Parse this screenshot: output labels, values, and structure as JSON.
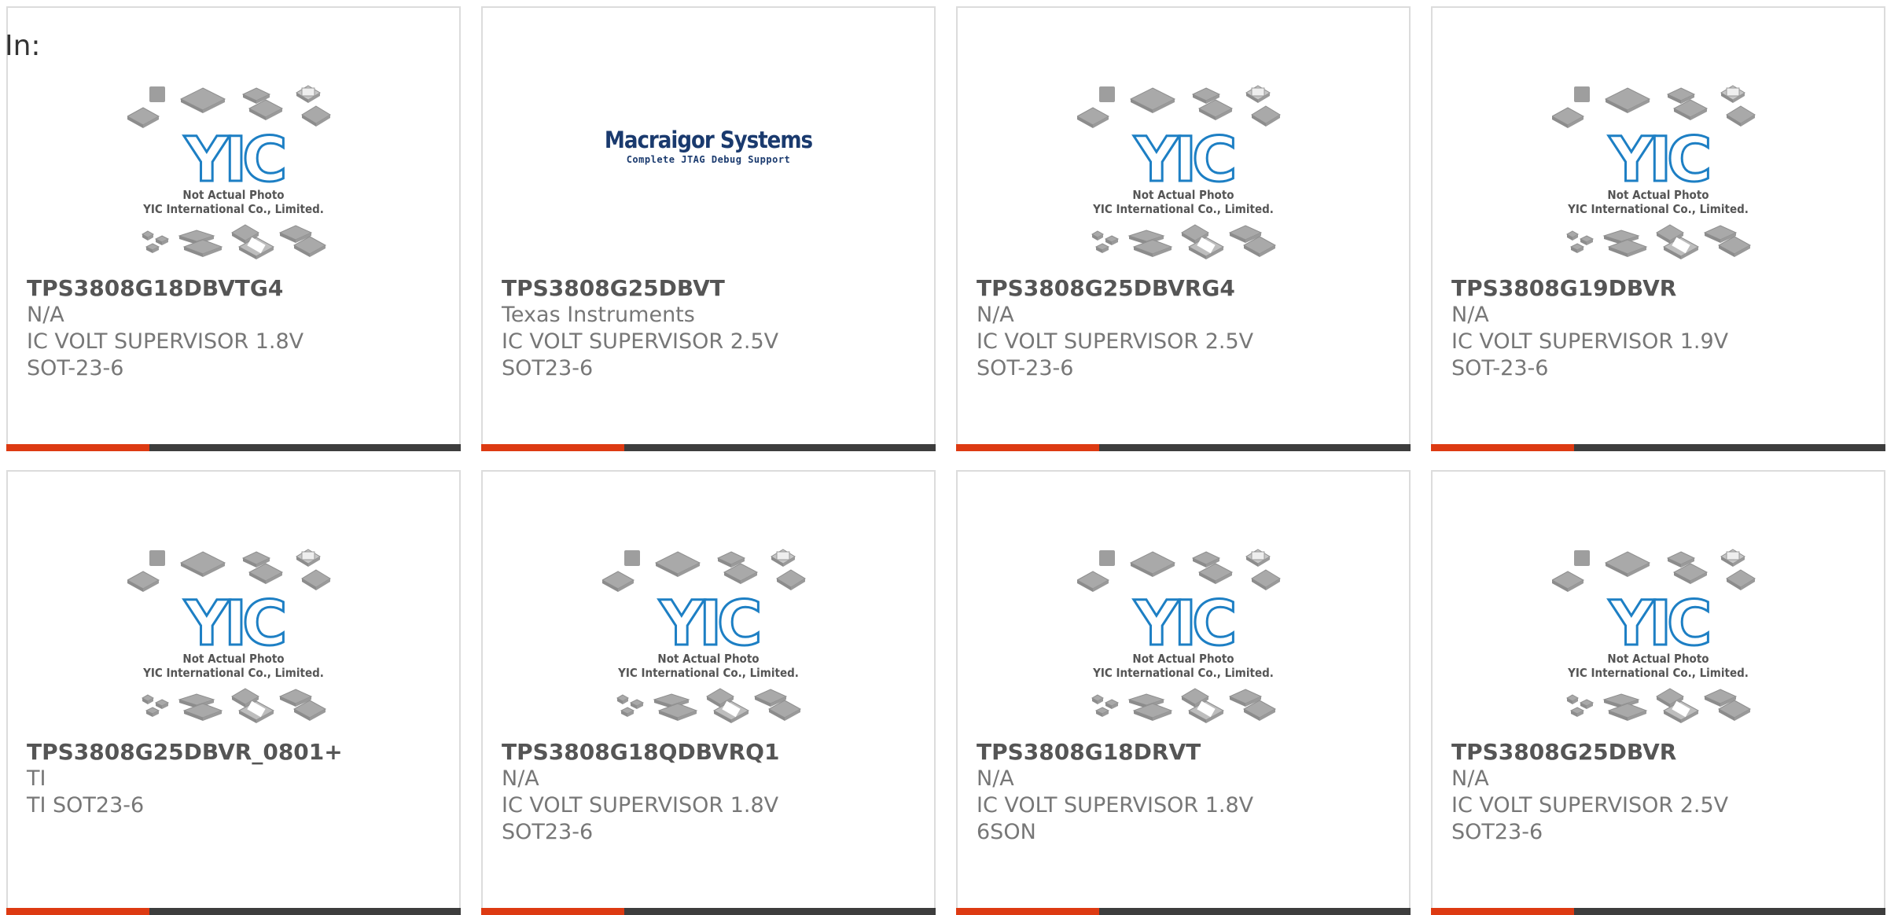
{
  "heading": "In:",
  "colors": {
    "accent": "#dd3a12",
    "bar": "#3d3d3d",
    "border": "#dcdcdc",
    "yic_blue": "#1d7fc4",
    "macraigor_navy": "#1a3a6e"
  },
  "placeholder_image": {
    "line1": "Not Actual Photo",
    "line2": "YIC International Co., Limited.",
    "logo_text": "YIC"
  },
  "macraigor_image": {
    "title": "Macraigor Systems",
    "subtitle": "Complete JTAG Debug Support"
  },
  "products": [
    {
      "part_number": "TPS3808G18DBVTG4",
      "manufacturer": "N/A",
      "description": "IC VOLT SUPERVISOR 1.8V SOT-23-6",
      "image": "yic-placeholder"
    },
    {
      "part_number": "TPS3808G25DBVT",
      "manufacturer": "Texas Instruments",
      "description": "IC VOLT SUPERVISOR 2.5V SOT23-6",
      "image": "macraigor-logo"
    },
    {
      "part_number": "TPS3808G25DBVRG4",
      "manufacturer": "N/A",
      "description": "IC VOLT SUPERVISOR 2.5V SOT-23-6",
      "image": "yic-placeholder"
    },
    {
      "part_number": "TPS3808G19DBVR",
      "manufacturer": "N/A",
      "description": "IC VOLT SUPERVISOR 1.9V SOT-23-6",
      "image": "yic-placeholder"
    },
    {
      "part_number": "TPS3808G25DBVR_0801+",
      "manufacturer": "TI",
      "description": "TI SOT23-6",
      "image": "yic-placeholder"
    },
    {
      "part_number": "TPS3808G18QDBVRQ1",
      "manufacturer": "N/A",
      "description": "IC VOLT SUPERVISOR 1.8V SOT23-6",
      "image": "yic-placeholder"
    },
    {
      "part_number": "TPS3808G18DRVT",
      "manufacturer": "N/A",
      "description": "IC VOLT SUPERVISOR 1.8V 6SON",
      "image": "yic-placeholder"
    },
    {
      "part_number": "TPS3808G25DBVR",
      "manufacturer": "N/A",
      "description": "IC VOLT SUPERVISOR 2.5V SOT23-6",
      "image": "yic-placeholder"
    }
  ]
}
